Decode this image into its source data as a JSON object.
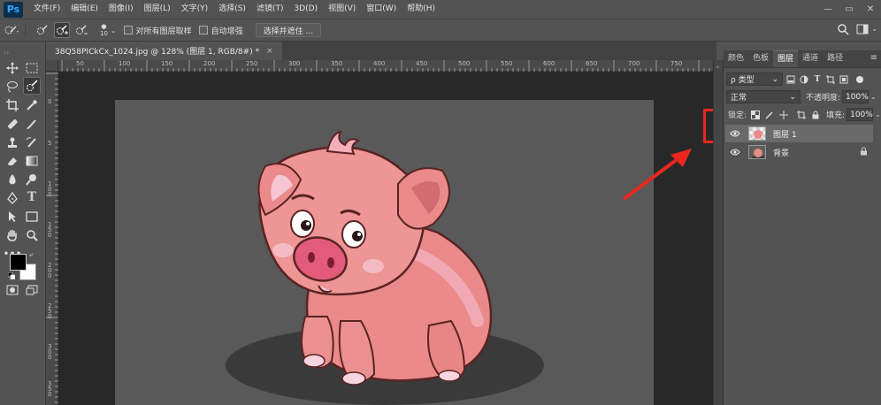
{
  "app": {
    "logo": "Ps"
  },
  "menu": [
    "文件(F)",
    "编辑(E)",
    "图像(I)",
    "图层(L)",
    "文字(Y)",
    "选择(S)",
    "滤镜(T)",
    "3D(D)",
    "视图(V)",
    "窗口(W)",
    "帮助(H)"
  ],
  "window_controls": {
    "minimize": "—",
    "restore": "▭",
    "close": "✕"
  },
  "options": {
    "brush_size": "10",
    "sample_all_layers": "对所有图层取样",
    "auto_enhance": "自动增强",
    "select_mask_button": "选择并遮住 ..."
  },
  "document": {
    "tab_title": "38Q58PICkCx_1024.jpg @ 128% (图层 1, RGB/8#) *",
    "close": "×"
  },
  "ruler_top": [
    "50",
    "100",
    "150",
    "200",
    "250",
    "300",
    "350",
    "400",
    "450",
    "500",
    "550",
    "600",
    "650",
    "700",
    "750"
  ],
  "ruler_left": [
    "0",
    "5",
    "1 0 0",
    "1 5 0",
    "2 0 0",
    "2 5 0",
    "3 0 0",
    "3 5 0"
  ],
  "panel": {
    "tabs": [
      "颜色",
      "色板",
      "图层",
      "通道",
      "路径"
    ],
    "active_tab": "图层",
    "menu_icon": "≡",
    "filter_label": "ρ 类型",
    "blend_mode": "正常",
    "opacity_label": "不透明度:",
    "opacity_value": "100%",
    "lock_label": "锁定:",
    "fill_label": "填充:",
    "fill_value": "100%",
    "layers": [
      {
        "name": "图层 1",
        "selected": true
      },
      {
        "name": "背景",
        "selected": false,
        "locked": true
      }
    ]
  },
  "colors": {
    "annotation_red": "#e8281f",
    "ps_blue": "#31a8ff",
    "foreground": "#000000",
    "background": "#ffffff"
  },
  "icons": {
    "window_search": "search-icon",
    "workspace": "workspace-icon"
  }
}
